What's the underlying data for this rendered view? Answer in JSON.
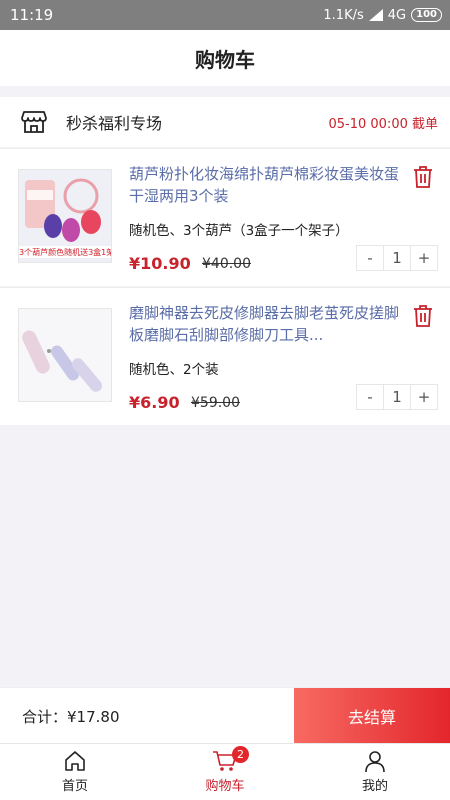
{
  "status_bar": {
    "time": "11:19",
    "network_speed": "1.1K/s",
    "network_type": "4G",
    "battery": "100"
  },
  "header": {
    "title": "购物车"
  },
  "store": {
    "name": "秒杀福利专场",
    "deadline": "05-10 00:00 截单",
    "icon": "store-icon"
  },
  "items": [
    {
      "title": "葫芦粉扑化妆海绵扑葫芦棉彩妆蛋美妆蛋干湿两用3个装",
      "spec": "随机色、3个葫芦（3盒子一个架子）",
      "price": "¥10.90",
      "original_price": "¥40.00",
      "quantity": "1",
      "image_caption": "3个葫芦颜色随机送3盒1架"
    },
    {
      "title": "磨脚神器去死皮修脚器去脚老茧死皮搓脚板磨脚石刮脚部修脚刀工具...",
      "spec": "随机色、2个装",
      "price": "¥6.90",
      "original_price": "¥59.00",
      "quantity": "1"
    }
  ],
  "stepper": {
    "minus": "-",
    "plus": "+"
  },
  "footer": {
    "total_label": "合计：¥17.80",
    "checkout_label": "去结算"
  },
  "tabs": [
    {
      "label": "首页",
      "icon": "home-icon"
    },
    {
      "label": "购物车",
      "icon": "cart-icon",
      "badge": "2"
    },
    {
      "label": "我的",
      "icon": "user-icon"
    }
  ],
  "colors": {
    "accent": "#c8222c",
    "checkout_gradient_start": "#f76a62",
    "checkout_gradient_end": "#e3262c",
    "title_link": "#5a6da8"
  }
}
